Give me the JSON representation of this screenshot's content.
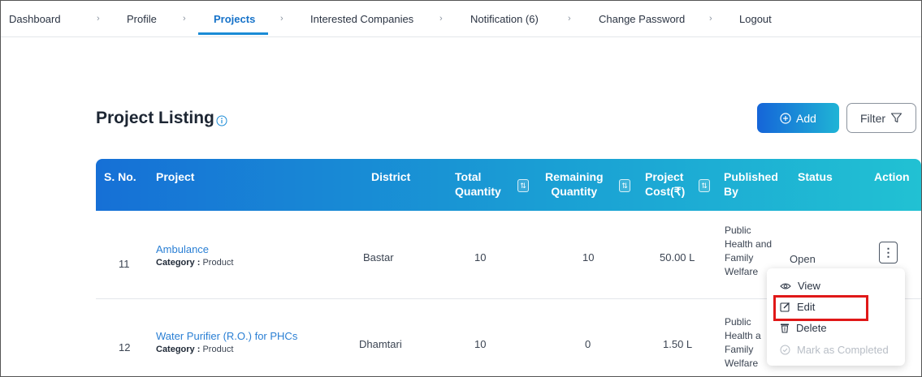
{
  "nav": {
    "items": [
      "Dashboard",
      "Profile",
      "Projects",
      "Interested Companies",
      "Notification (6)",
      "Change Password",
      "Logout"
    ],
    "active": "Projects",
    "separator": "›"
  },
  "header": {
    "title": "Project Listing",
    "add_label": "Add",
    "filter_label": "Filter"
  },
  "table": {
    "columns": {
      "sno": "S. No.",
      "project": "Project",
      "district": "District",
      "total_1": "Total",
      "total_2": "Quantity",
      "remaining_1": "Remaining",
      "remaining_2": "Quantity",
      "cost_1": "Project",
      "cost_2": "Cost(₹)",
      "published_1": "Published",
      "published_2": "By",
      "status": "Status",
      "action": "Action"
    },
    "category_label": "Category :",
    "rows": [
      {
        "sno": "11",
        "project": "Ambulance",
        "category": "Product",
        "district": "Bastar",
        "total": "10",
        "remaining": "10",
        "cost": "50.00 L",
        "published": [
          "Public",
          "Health and",
          "Family",
          "Welfare"
        ],
        "status": "Open"
      },
      {
        "sno": "12",
        "project": "Water Purifier (R.O.) for PHCs",
        "category": "Product",
        "district": "Dhamtari",
        "total": "10",
        "remaining": "0",
        "cost": "1.50 L",
        "published": [
          "Public",
          "Health a",
          "Family",
          "Welfare"
        ],
        "status": ""
      }
    ]
  },
  "action_menu": {
    "view": "View",
    "edit": "Edit",
    "delete": "Delete",
    "mark_completed": "Mark as Completed"
  },
  "colors": {
    "accent": "#1a8bd6",
    "header_gradient_start": "#1670d6",
    "header_gradient_end": "#21c1d3",
    "link": "#2a7fd4",
    "highlight": "#e01818"
  }
}
